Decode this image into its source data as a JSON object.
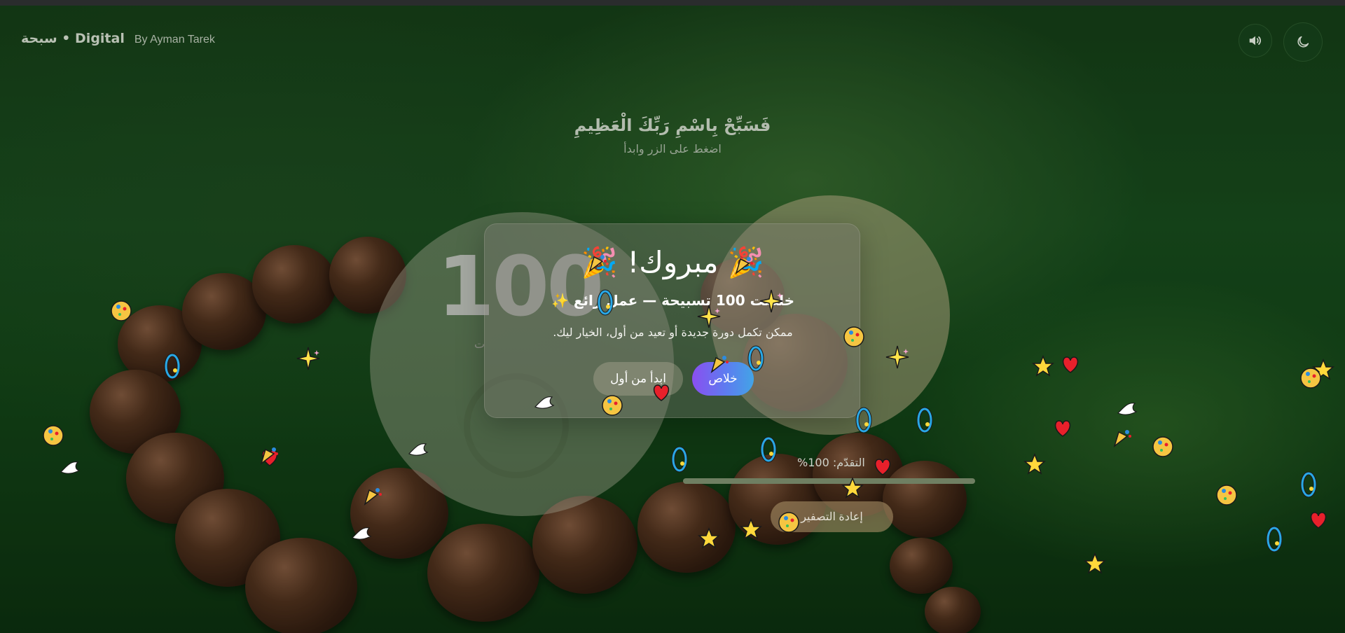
{
  "header": {
    "brand": "سبحة • Digital",
    "author": "By Ayman Tarek",
    "sound_icon": "speaker-icon",
    "theme_icon": "moon-icon"
  },
  "verse": {
    "main": "فَسَبِّحْ بِاسْمِ رَبِّكَ الْعَظِيمِ",
    "sub": "اضغط على الزر وابدأ"
  },
  "counter": {
    "value": "100"
  },
  "progress": {
    "label": "التقدّم: 100%",
    "percent": 100
  },
  "reset_button": "إعادة التصفير",
  "modal": {
    "title": "🎉 مبروك! 🎉",
    "subtitle": "خلصت 100 تسبيحة — عمل رائع ✨",
    "text": "ممكن تكمل دورة جديدة أو تعيد من أول، الخيار ليك.",
    "restart_button": "ابدأ من أول",
    "done_button": "خلاص"
  },
  "colors": {
    "accent_gradient_start": "#8a4ff0",
    "accent_gradient_end": "#43a4e6",
    "background_green": "#1c5a22"
  }
}
